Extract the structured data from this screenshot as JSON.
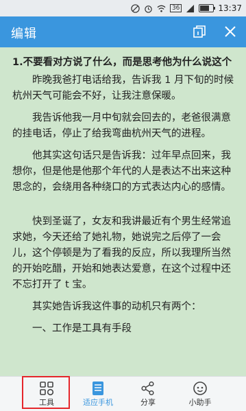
{
  "status_bar": {
    "signal_badge": "36",
    "time": "13:37"
  },
  "header": {
    "title": "编辑",
    "copy_icon": "copy-pages-icon",
    "close_icon": "close-icon"
  },
  "article": {
    "heading": "1.不要看对方说了什么，而是思考他为什么说这个",
    "paragraphs": [
      "昨晚我爸打电话给我，告诉我 1 月下旬的时候杭州天气可能会不好，让我注意保暖。",
      "我告诉他我一月中旬就会回去的，老爸很满意的挂电话，停止了给我弯曲杭州天气的进程。",
      "他其实这句话只是告诉我：过年早点回来，我想你，但是他是他那个年代的人是表达不出来这种思念的，会绕用各种绕口的方式表达内心的感情。",
      "快到圣诞了，女友和我讲最近有个男生经常追求她，今天还给了她礼物，她说完之后停了一会儿，这个停顿是为了看我的反应，所以我理所当然的开始吃醋，开始和她表达爱意，在这个过程中还不忘打开了 t 宝。",
      "其实她告诉我这件事的动机只有两个：",
      "一、工作是工具有手段"
    ]
  },
  "tabs": [
    {
      "label": "工具",
      "icon": "tools-grid-icon",
      "active": false
    },
    {
      "label": "适应手机",
      "icon": "fit-phone-icon",
      "active": true
    },
    {
      "label": "分享",
      "icon": "share-icon",
      "active": false
    },
    {
      "label": "小助手",
      "icon": "assistant-icon",
      "active": false
    }
  ],
  "colors": {
    "header_bg": "#3a96de",
    "content_bg": "#cfe6cd",
    "accent": "#3a96de",
    "highlight_box": "#e5262b"
  }
}
